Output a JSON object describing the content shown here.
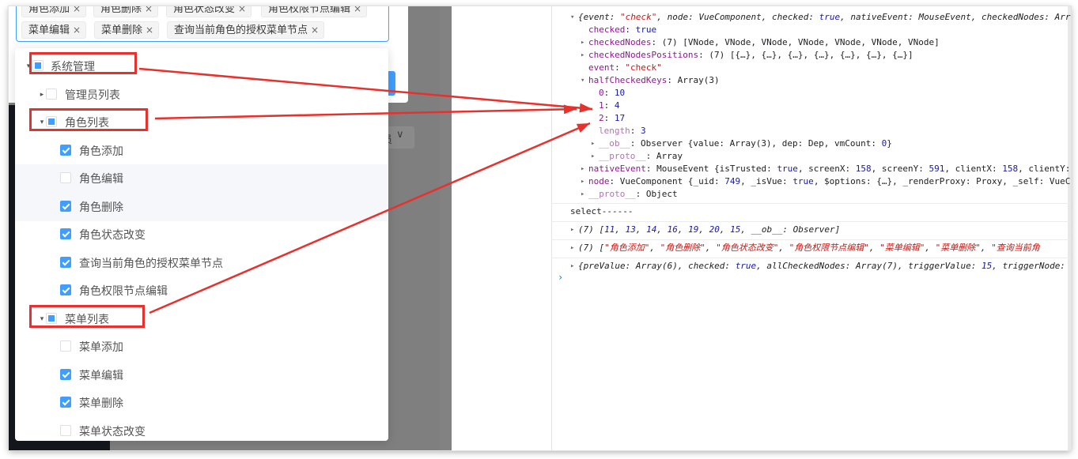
{
  "tags": [
    {
      "label": "角色添加"
    },
    {
      "label": "角色删除"
    },
    {
      "label": "角色状态改变"
    },
    {
      "label": "角色权限节点编辑"
    },
    {
      "label": "菜单编辑"
    },
    {
      "label": "菜单删除"
    },
    {
      "label": "查询当前角色的授权菜单节点"
    }
  ],
  "tag_close_glyph": "×",
  "select_stub": {
    "text": "员",
    "arrow": "∨"
  },
  "tree": [
    {
      "label": "系统管理",
      "level": 0,
      "caret": "▾",
      "state": "half"
    },
    {
      "label": "管理员列表",
      "level": 1,
      "caret": "▸",
      "state": "unchecked"
    },
    {
      "label": "角色列表",
      "level": 1,
      "caret": "▾",
      "state": "half"
    },
    {
      "label": "角色添加",
      "level": 2,
      "state": "checked"
    },
    {
      "label": "角色编辑",
      "level": 2,
      "state": "unchecked"
    },
    {
      "label": "角色删除",
      "level": 2,
      "state": "checked"
    },
    {
      "label": "角色状态改变",
      "level": 2,
      "state": "checked"
    },
    {
      "label": "查询当前角色的授权菜单节点",
      "level": 2,
      "state": "checked"
    },
    {
      "label": "角色权限节点编辑",
      "level": 2,
      "state": "checked"
    },
    {
      "label": "菜单列表",
      "level": 1,
      "caret": "▾",
      "state": "half"
    },
    {
      "label": "菜单添加",
      "level": 2,
      "state": "unchecked"
    },
    {
      "label": "菜单编辑",
      "level": 2,
      "state": "checked"
    },
    {
      "label": "菜单删除",
      "level": 2,
      "state": "checked"
    },
    {
      "label": "菜单状态改变",
      "level": 2,
      "state": "unchecked"
    }
  ],
  "colors": {
    "accent": "#409eff",
    "annotation": "#e8302c"
  },
  "icons": {
    "expanded": "caret-down-icon",
    "collapsed": "caret-right-icon",
    "console_prompt": "chevron-right-icon"
  },
  "console": {
    "prompt": "›",
    "lines": [
      {
        "indent": 0,
        "arrow": "▾",
        "italic": true,
        "segs": [
          [
            "p",
            "{event: "
          ],
          [
            "s",
            "\"check\""
          ],
          [
            "p",
            ", node: VueComponent, checked: "
          ],
          [
            "n",
            "true"
          ],
          [
            "p",
            ", nativeEvent: MouseEvent, checkedNodes: Arr"
          ]
        ]
      },
      {
        "indent": 1,
        "arrow": "",
        "segs": [
          [
            "k",
            "checked"
          ],
          [
            "p",
            ": "
          ],
          [
            "n",
            "true"
          ]
        ]
      },
      {
        "indent": 1,
        "arrow": "▸",
        "segs": [
          [
            "k",
            "checkedNodes"
          ],
          [
            "p",
            ": (7) [VNode, VNode, VNode, VNode, VNode, VNode, VNode]"
          ]
        ]
      },
      {
        "indent": 1,
        "arrow": "▸",
        "segs": [
          [
            "k",
            "checkedNodesPositions"
          ],
          [
            "p",
            ": (7) [{…}, {…}, {…}, {…}, {…}, {…}, {…}]"
          ]
        ]
      },
      {
        "indent": 1,
        "arrow": "",
        "segs": [
          [
            "k",
            "event"
          ],
          [
            "p",
            ": "
          ],
          [
            "s",
            "\"check\""
          ]
        ]
      },
      {
        "indent": 1,
        "arrow": "▾",
        "segs": [
          [
            "k",
            "halfCheckedKeys"
          ],
          [
            "p",
            ": Array(3)"
          ]
        ]
      },
      {
        "indent": 2,
        "arrow": "",
        "segs": [
          [
            "k",
            "0"
          ],
          [
            "p",
            ": "
          ],
          [
            "n",
            "10"
          ]
        ]
      },
      {
        "indent": 2,
        "arrow": "",
        "segs": [
          [
            "k",
            "1"
          ],
          [
            "p",
            ": "
          ],
          [
            "n",
            "4"
          ]
        ]
      },
      {
        "indent": 2,
        "arrow": "",
        "segs": [
          [
            "k",
            "2"
          ],
          [
            "p",
            ": "
          ],
          [
            "n",
            "17"
          ]
        ]
      },
      {
        "indent": 2,
        "arrow": "",
        "segs": [
          [
            "kd",
            "length"
          ],
          [
            "p",
            ": "
          ],
          [
            "n",
            "3"
          ]
        ]
      },
      {
        "indent": 2,
        "arrow": "▸",
        "segs": [
          [
            "kd",
            "__ob__"
          ],
          [
            "p",
            ": Observer {value: Array(3), dep: Dep, vmCount: "
          ],
          [
            "n",
            "0"
          ],
          [
            "p",
            "}"
          ]
        ]
      },
      {
        "indent": 2,
        "arrow": "▸",
        "segs": [
          [
            "kd",
            "__proto__"
          ],
          [
            "p",
            ": Array"
          ]
        ]
      },
      {
        "indent": 1,
        "arrow": "▸",
        "segs": [
          [
            "k",
            "nativeEvent"
          ],
          [
            "p",
            ": MouseEvent {isTrusted: "
          ],
          [
            "n",
            "true"
          ],
          [
            "p",
            ", screenX: "
          ],
          [
            "n",
            "158"
          ],
          [
            "p",
            ", screenY: "
          ],
          [
            "n",
            "591"
          ],
          [
            "p",
            ", clientX: "
          ],
          [
            "n",
            "158"
          ],
          [
            "p",
            ", clientY:"
          ]
        ]
      },
      {
        "indent": 1,
        "arrow": "▸",
        "segs": [
          [
            "k",
            "node"
          ],
          [
            "p",
            ": VueComponent {_uid: "
          ],
          [
            "n",
            "749"
          ],
          [
            "p",
            ", _isVue: "
          ],
          [
            "n",
            "true"
          ],
          [
            "p",
            ", $options: {…}, _renderProxy: Proxy, _self: VueC"
          ]
        ]
      },
      {
        "indent": 1,
        "arrow": "▸",
        "segs": [
          [
            "kd",
            "__proto__"
          ],
          [
            "p",
            ": Object"
          ]
        ]
      },
      {
        "indent": -1,
        "arrow": "",
        "sep_before": true,
        "segs": [
          [
            "p",
            "select------"
          ]
        ]
      },
      {
        "indent": 0,
        "arrow": "▸",
        "italic": true,
        "sep_before": true,
        "segs": [
          [
            "p",
            "(7) ["
          ],
          [
            "n",
            "11"
          ],
          [
            "p",
            ", "
          ],
          [
            "n",
            "13"
          ],
          [
            "p",
            ", "
          ],
          [
            "n",
            "14"
          ],
          [
            "p",
            ", "
          ],
          [
            "n",
            "16"
          ],
          [
            "p",
            ", "
          ],
          [
            "n",
            "19"
          ],
          [
            "p",
            ", "
          ],
          [
            "n",
            "20"
          ],
          [
            "p",
            ", "
          ],
          [
            "n",
            "15"
          ],
          [
            "p",
            ", __ob__: Observer]"
          ]
        ]
      },
      {
        "indent": 0,
        "arrow": "▸",
        "italic": true,
        "sep_before": true,
        "segs": [
          [
            "p",
            "(7) ["
          ],
          [
            "s",
            "\"角色添加\""
          ],
          [
            "p",
            ", "
          ],
          [
            "s",
            "\"角色删除\""
          ],
          [
            "p",
            ", "
          ],
          [
            "s",
            "\"角色状态改变\""
          ],
          [
            "p",
            ", "
          ],
          [
            "s",
            "\"角色权限节点编辑\""
          ],
          [
            "p",
            ", "
          ],
          [
            "s",
            "\"菜单编辑\""
          ],
          [
            "p",
            ", "
          ],
          [
            "s",
            "\"菜单删除\""
          ],
          [
            "p",
            ", "
          ],
          [
            "s",
            "\"查询当前角"
          ]
        ]
      },
      {
        "indent": 0,
        "arrow": "▸",
        "italic": true,
        "sep_before": true,
        "segs": [
          [
            "p",
            "{preValue: Array(6), checked: "
          ],
          [
            "n",
            "true"
          ],
          [
            "p",
            ", allCheckedNodes: Array(7), triggerValue: "
          ],
          [
            "n",
            "15"
          ],
          [
            "p",
            ", triggerNode:"
          ]
        ]
      }
    ]
  }
}
